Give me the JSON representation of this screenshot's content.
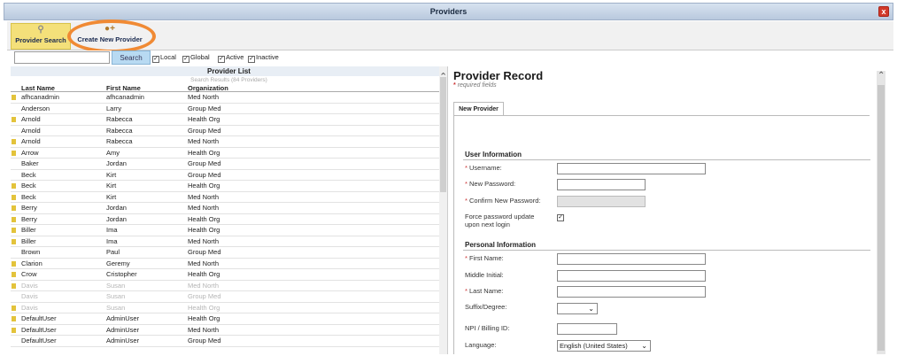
{
  "window": {
    "title": "Providers",
    "close": "x"
  },
  "toolbar": {
    "provider_search": "Provider Search",
    "create_new": "Create New Provider"
  },
  "search": {
    "value": "",
    "button": "Search",
    "filters": [
      {
        "label": "Local",
        "checked": true
      },
      {
        "label": "Global",
        "checked": true
      },
      {
        "label": "Active",
        "checked": true
      },
      {
        "label": "Inactive",
        "checked": true
      }
    ]
  },
  "list": {
    "title": "Provider List",
    "subtitle": "Search Results (84 Providers)",
    "columns": [
      "Last Name",
      "First Name",
      "Organization"
    ],
    "rows": [
      {
        "last": "afhcanadmin",
        "first": "afhcanadmin",
        "org": "Med North",
        "star": true,
        "disabled": false
      },
      {
        "last": "Anderson",
        "first": "Larry",
        "org": "Group Med",
        "star": false,
        "disabled": false
      },
      {
        "last": "Arnold",
        "first": "Rabecca",
        "org": "Health Org",
        "star": true,
        "disabled": false
      },
      {
        "last": "Arnold",
        "first": "Rabecca",
        "org": "Group Med",
        "star": false,
        "disabled": false
      },
      {
        "last": "Arnold",
        "first": "Rabecca",
        "org": "Med North",
        "star": true,
        "disabled": false
      },
      {
        "last": "Arrow",
        "first": "Amy",
        "org": "Health Org",
        "star": true,
        "disabled": false
      },
      {
        "last": "Baker",
        "first": "Jordan",
        "org": "Group Med",
        "star": false,
        "disabled": false
      },
      {
        "last": "Beck",
        "first": "Kirt",
        "org": "Group Med",
        "star": false,
        "disabled": false
      },
      {
        "last": "Beck",
        "first": "Kirt",
        "org": "Health Org",
        "star": true,
        "disabled": false
      },
      {
        "last": "Beck",
        "first": "Kirt",
        "org": "Med North",
        "star": true,
        "disabled": false
      },
      {
        "last": "Berry",
        "first": "Jordan",
        "org": "Med North",
        "star": true,
        "disabled": false
      },
      {
        "last": "Berry",
        "first": "Jordan",
        "org": "Health Org",
        "star": true,
        "disabled": false
      },
      {
        "last": "Biller",
        "first": "Ima",
        "org": "Health Org",
        "star": true,
        "disabled": false
      },
      {
        "last": "Biller",
        "first": "Ima",
        "org": "Med North",
        "star": true,
        "disabled": false
      },
      {
        "last": "Brown",
        "first": "Paul",
        "org": "Group Med",
        "star": false,
        "disabled": false
      },
      {
        "last": "Clarion",
        "first": "Geremy",
        "org": "Med North",
        "star": true,
        "disabled": false
      },
      {
        "last": "Crow",
        "first": "Cristopher",
        "org": "Health Org",
        "star": true,
        "disabled": false
      },
      {
        "last": "Davis",
        "first": "Susan",
        "org": "Med North",
        "star": true,
        "disabled": true
      },
      {
        "last": "Davis",
        "first": "Susan",
        "org": "Group Med",
        "star": false,
        "disabled": true
      },
      {
        "last": "Davis",
        "first": "Susan",
        "org": "Health Org",
        "star": true,
        "disabled": true
      },
      {
        "last": "DefaultUser",
        "first": "AdminUser",
        "org": "Health Org",
        "star": true,
        "disabled": false
      },
      {
        "last": "DefaultUser",
        "first": "AdminUser",
        "org": "Med North",
        "star": true,
        "disabled": false
      },
      {
        "last": "DefaultUser",
        "first": "AdminUser",
        "org": "Group Med",
        "star": false,
        "disabled": false
      }
    ]
  },
  "record": {
    "title": "Provider Record",
    "required_note": "required fields",
    "required_mark": "*",
    "tab": "New Provider",
    "user_info": {
      "heading": "User Information",
      "username": "Username:",
      "new_password": "New Password:",
      "confirm_password": "Confirm New Password:",
      "force_update": "Force password update upon next login"
    },
    "personal_info": {
      "heading": "Personal Information",
      "first_name": "First Name:",
      "middle_initial": "Middle Initial:",
      "last_name": "Last Name:",
      "suffix": "Suffix/Degree:",
      "npi": "NPI / Billing ID:",
      "language": "Language:",
      "language_value": "English (United States)"
    }
  }
}
